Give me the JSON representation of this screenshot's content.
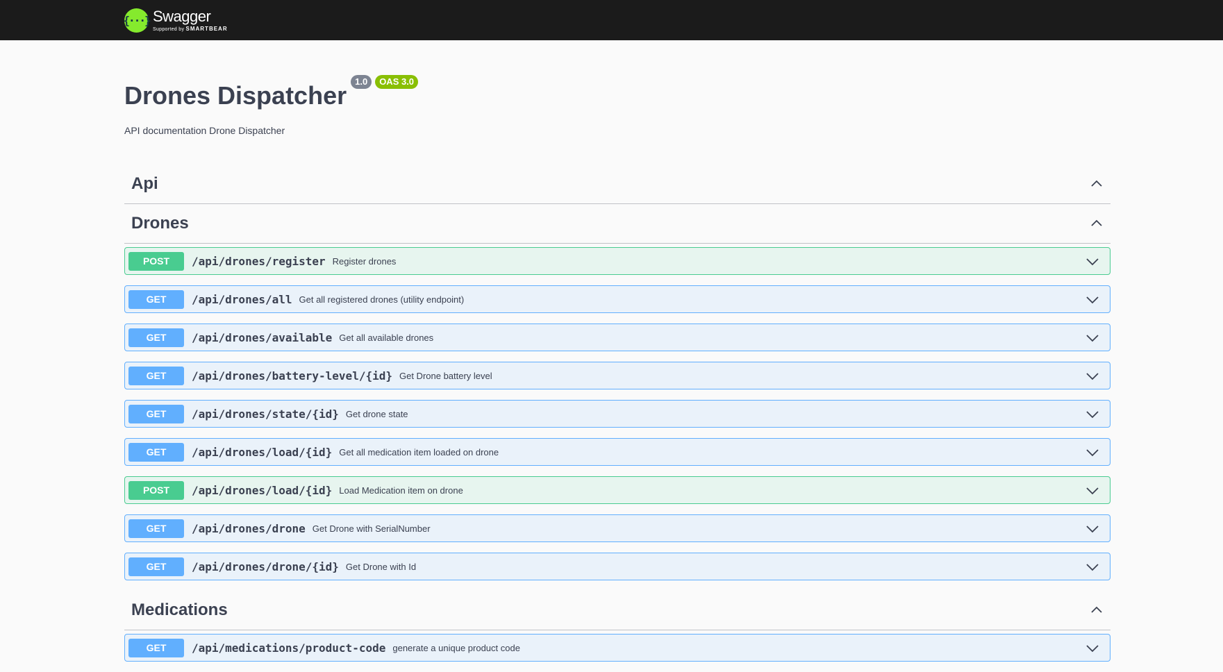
{
  "topbar": {
    "logo_glyph": "{···}",
    "brand": "Swagger",
    "supported_by": "Supported by",
    "company": "SMARTBEAR"
  },
  "info": {
    "title": "Drones Dispatcher",
    "version": "1.0",
    "oas": "OAS 3.0",
    "description": "API documentation Drone Dispatcher"
  },
  "tags": [
    {
      "name": "Api",
      "ops": []
    },
    {
      "name": "Drones",
      "ops": [
        {
          "method": "POST",
          "path": "/api/drones/register",
          "summary": "Register drones"
        },
        {
          "method": "GET",
          "path": "/api/drones/all",
          "summary": "Get all registered drones (utility endpoint)"
        },
        {
          "method": "GET",
          "path": "/api/drones/available",
          "summary": "Get all available drones"
        },
        {
          "method": "GET",
          "path": "/api/drones/battery-level/{id}",
          "summary": "Get Drone battery level"
        },
        {
          "method": "GET",
          "path": "/api/drones/state/{id}",
          "summary": "Get drone state"
        },
        {
          "method": "GET",
          "path": "/api/drones/load/{id}",
          "summary": "Get all medication item loaded on drone"
        },
        {
          "method": "POST",
          "path": "/api/drones/load/{id}",
          "summary": "Load Medication item on drone"
        },
        {
          "method": "GET",
          "path": "/api/drones/drone",
          "summary": "Get Drone with SerialNumber"
        },
        {
          "method": "GET",
          "path": "/api/drones/drone/{id}",
          "summary": "Get Drone with Id"
        }
      ]
    },
    {
      "name": "Medications",
      "ops": [
        {
          "method": "GET",
          "path": "/api/medications/product-code",
          "summary": "generate a unique product code"
        }
      ]
    }
  ],
  "colors": {
    "get": "#61affe",
    "post": "#49cc90",
    "topbar": "#1b1b1b",
    "logo": "#85ea2d"
  },
  "icons": {
    "collapse": "chevron-up-icon",
    "expand": "chevron-down-icon"
  }
}
